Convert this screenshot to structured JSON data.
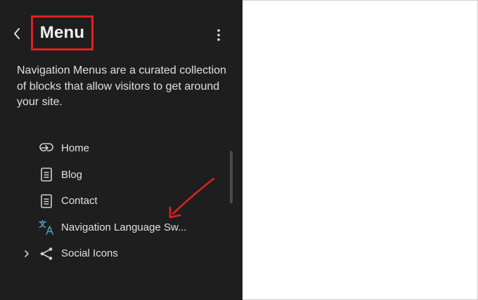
{
  "panel": {
    "title": "Menu",
    "description": "Navigation Menus are a curated collection of blocks that allow visitors to get around your site."
  },
  "nav": {
    "items": [
      {
        "label": "Home",
        "icon": "page-link-icon"
      },
      {
        "label": "Blog",
        "icon": "page-icon"
      },
      {
        "label": "Contact",
        "icon": "page-icon"
      },
      {
        "label": "Navigation Language Sw...",
        "icon": "translate-icon"
      },
      {
        "label": "Social Icons",
        "icon": "share-icon",
        "expandable": true
      }
    ]
  },
  "colors": {
    "panel_bg": "#1e1e1e",
    "annotation": "#e02020",
    "translate_icon": "#4aa3c7"
  }
}
